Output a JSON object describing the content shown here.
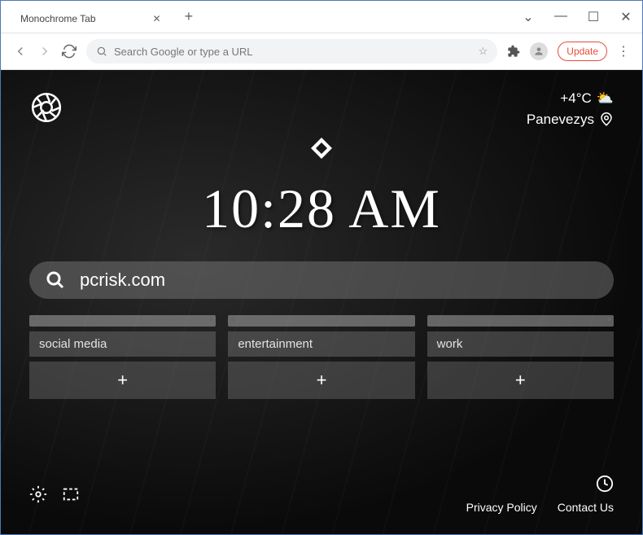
{
  "window": {
    "tab_title": "Monochrome Tab"
  },
  "toolbar": {
    "omnibox_placeholder": "Search Google or type a URL",
    "update_label": "Update"
  },
  "weather": {
    "temperature": "+4°C",
    "location": "Panevezys"
  },
  "clock": {
    "time": "10:28 AM"
  },
  "search": {
    "value": "pcrisk.com"
  },
  "categories": [
    {
      "label": "social media"
    },
    {
      "label": "entertainment"
    },
    {
      "label": "work"
    }
  ],
  "footer": {
    "privacy": "Privacy Policy",
    "contact": "Contact Us"
  }
}
